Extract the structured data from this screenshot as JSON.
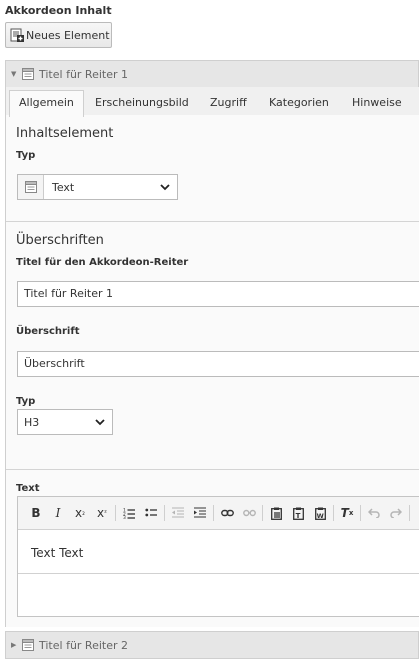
{
  "section_label": "Akkordeon Inhalt",
  "new_element_button": {
    "label": "Neues Element",
    "icon": "new-element-icon"
  },
  "accordion_items": [
    {
      "title": "Titel für Reiter 1",
      "expanded": true
    },
    {
      "title": "Titel für Reiter 2",
      "expanded": false
    }
  ],
  "tabs": [
    {
      "label": "Allgemein",
      "active": true
    },
    {
      "label": "Erscheinungsbild",
      "active": false
    },
    {
      "label": "Zugriff",
      "active": false
    },
    {
      "label": "Kategorien",
      "active": false
    },
    {
      "label": "Hinweise",
      "active": false
    }
  ],
  "content_element": {
    "title": "Inhaltselement",
    "type_label": "Typ",
    "type_value": "Text",
    "type_icon": "text-content-icon"
  },
  "headers": {
    "title": "Überschriften",
    "tab_title_label": "Titel für den Akkordeon-Reiter",
    "tab_title_value": "Titel für Reiter 1",
    "heading_label": "Überschrift",
    "heading_value": "Überschrift",
    "heading_type_label": "Typ",
    "heading_type_value": "H3"
  },
  "text_field": {
    "label": "Text",
    "value": "Text Text",
    "toolbar_icons": [
      "bold-icon",
      "italic-icon",
      "subscript-icon",
      "superscript-icon",
      "ordered-list-icon",
      "unordered-list-icon",
      "outdent-icon",
      "indent-icon",
      "link-icon",
      "unlink-icon",
      "paste-icon",
      "paste-text-icon",
      "paste-word-icon",
      "remove-format-icon",
      "undo-icon",
      "redo-icon"
    ]
  },
  "colors": {
    "panel_header_bg": "#e6e6e6",
    "tab_bar_bg": "#f0f0f0",
    "content_bg": "#fafafa",
    "border": "#cfcfcf"
  }
}
